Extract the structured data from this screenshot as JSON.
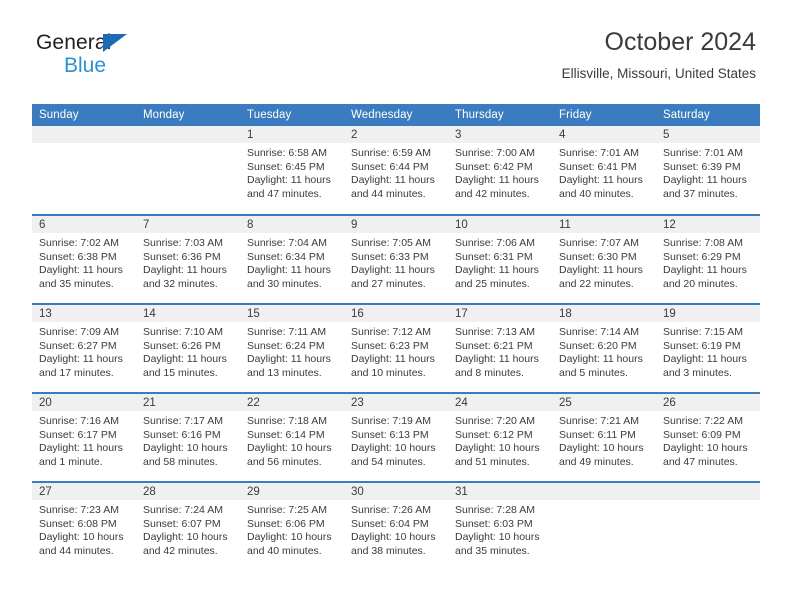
{
  "brand": {
    "name_top": "General",
    "name_bottom": "Blue",
    "triangle_color": "#1b6cb5",
    "blue_text_color": "#2d8fd5"
  },
  "header": {
    "title": "October 2024",
    "location": "Ellisville, Missouri, United States"
  },
  "theme": {
    "header_blue": "#3b7cc0",
    "daynum_band": "#f0f0f0",
    "text": "#3b3b3b"
  },
  "weekday_headers": [
    "Sunday",
    "Monday",
    "Tuesday",
    "Wednesday",
    "Thursday",
    "Friday",
    "Saturday"
  ],
  "weeks": [
    [
      {
        "day": "",
        "sunrise": "",
        "sunset": "",
        "daylight_line1": "",
        "daylight_line2": "",
        "blank": true
      },
      {
        "day": "",
        "sunrise": "",
        "sunset": "",
        "daylight_line1": "",
        "daylight_line2": "",
        "blank": true
      },
      {
        "day": "1",
        "sunrise": "Sunrise: 6:58 AM",
        "sunset": "Sunset: 6:45 PM",
        "daylight_line1": "Daylight: 11 hours",
        "daylight_line2": "and 47 minutes."
      },
      {
        "day": "2",
        "sunrise": "Sunrise: 6:59 AM",
        "sunset": "Sunset: 6:44 PM",
        "daylight_line1": "Daylight: 11 hours",
        "daylight_line2": "and 44 minutes."
      },
      {
        "day": "3",
        "sunrise": "Sunrise: 7:00 AM",
        "sunset": "Sunset: 6:42 PM",
        "daylight_line1": "Daylight: 11 hours",
        "daylight_line2": "and 42 minutes."
      },
      {
        "day": "4",
        "sunrise": "Sunrise: 7:01 AM",
        "sunset": "Sunset: 6:41 PM",
        "daylight_line1": "Daylight: 11 hours",
        "daylight_line2": "and 40 minutes."
      },
      {
        "day": "5",
        "sunrise": "Sunrise: 7:01 AM",
        "sunset": "Sunset: 6:39 PM",
        "daylight_line1": "Daylight: 11 hours",
        "daylight_line2": "and 37 minutes."
      }
    ],
    [
      {
        "day": "6",
        "sunrise": "Sunrise: 7:02 AM",
        "sunset": "Sunset: 6:38 PM",
        "daylight_line1": "Daylight: 11 hours",
        "daylight_line2": "and 35 minutes."
      },
      {
        "day": "7",
        "sunrise": "Sunrise: 7:03 AM",
        "sunset": "Sunset: 6:36 PM",
        "daylight_line1": "Daylight: 11 hours",
        "daylight_line2": "and 32 minutes."
      },
      {
        "day": "8",
        "sunrise": "Sunrise: 7:04 AM",
        "sunset": "Sunset: 6:34 PM",
        "daylight_line1": "Daylight: 11 hours",
        "daylight_line2": "and 30 minutes."
      },
      {
        "day": "9",
        "sunrise": "Sunrise: 7:05 AM",
        "sunset": "Sunset: 6:33 PM",
        "daylight_line1": "Daylight: 11 hours",
        "daylight_line2": "and 27 minutes."
      },
      {
        "day": "10",
        "sunrise": "Sunrise: 7:06 AM",
        "sunset": "Sunset: 6:31 PM",
        "daylight_line1": "Daylight: 11 hours",
        "daylight_line2": "and 25 minutes."
      },
      {
        "day": "11",
        "sunrise": "Sunrise: 7:07 AM",
        "sunset": "Sunset: 6:30 PM",
        "daylight_line1": "Daylight: 11 hours",
        "daylight_line2": "and 22 minutes."
      },
      {
        "day": "12",
        "sunrise": "Sunrise: 7:08 AM",
        "sunset": "Sunset: 6:29 PM",
        "daylight_line1": "Daylight: 11 hours",
        "daylight_line2": "and 20 minutes."
      }
    ],
    [
      {
        "day": "13",
        "sunrise": "Sunrise: 7:09 AM",
        "sunset": "Sunset: 6:27 PM",
        "daylight_line1": "Daylight: 11 hours",
        "daylight_line2": "and 17 minutes."
      },
      {
        "day": "14",
        "sunrise": "Sunrise: 7:10 AM",
        "sunset": "Sunset: 6:26 PM",
        "daylight_line1": "Daylight: 11 hours",
        "daylight_line2": "and 15 minutes."
      },
      {
        "day": "15",
        "sunrise": "Sunrise: 7:11 AM",
        "sunset": "Sunset: 6:24 PM",
        "daylight_line1": "Daylight: 11 hours",
        "daylight_line2": "and 13 minutes."
      },
      {
        "day": "16",
        "sunrise": "Sunrise: 7:12 AM",
        "sunset": "Sunset: 6:23 PM",
        "daylight_line1": "Daylight: 11 hours",
        "daylight_line2": "and 10 minutes."
      },
      {
        "day": "17",
        "sunrise": "Sunrise: 7:13 AM",
        "sunset": "Sunset: 6:21 PM",
        "daylight_line1": "Daylight: 11 hours",
        "daylight_line2": "and 8 minutes."
      },
      {
        "day": "18",
        "sunrise": "Sunrise: 7:14 AM",
        "sunset": "Sunset: 6:20 PM",
        "daylight_line1": "Daylight: 11 hours",
        "daylight_line2": "and 5 minutes."
      },
      {
        "day": "19",
        "sunrise": "Sunrise: 7:15 AM",
        "sunset": "Sunset: 6:19 PM",
        "daylight_line1": "Daylight: 11 hours",
        "daylight_line2": "and 3 minutes."
      }
    ],
    [
      {
        "day": "20",
        "sunrise": "Sunrise: 7:16 AM",
        "sunset": "Sunset: 6:17 PM",
        "daylight_line1": "Daylight: 11 hours",
        "daylight_line2": "and 1 minute."
      },
      {
        "day": "21",
        "sunrise": "Sunrise: 7:17 AM",
        "sunset": "Sunset: 6:16 PM",
        "daylight_line1": "Daylight: 10 hours",
        "daylight_line2": "and 58 minutes."
      },
      {
        "day": "22",
        "sunrise": "Sunrise: 7:18 AM",
        "sunset": "Sunset: 6:14 PM",
        "daylight_line1": "Daylight: 10 hours",
        "daylight_line2": "and 56 minutes."
      },
      {
        "day": "23",
        "sunrise": "Sunrise: 7:19 AM",
        "sunset": "Sunset: 6:13 PM",
        "daylight_line1": "Daylight: 10 hours",
        "daylight_line2": "and 54 minutes."
      },
      {
        "day": "24",
        "sunrise": "Sunrise: 7:20 AM",
        "sunset": "Sunset: 6:12 PM",
        "daylight_line1": "Daylight: 10 hours",
        "daylight_line2": "and 51 minutes."
      },
      {
        "day": "25",
        "sunrise": "Sunrise: 7:21 AM",
        "sunset": "Sunset: 6:11 PM",
        "daylight_line1": "Daylight: 10 hours",
        "daylight_line2": "and 49 minutes."
      },
      {
        "day": "26",
        "sunrise": "Sunrise: 7:22 AM",
        "sunset": "Sunset: 6:09 PM",
        "daylight_line1": "Daylight: 10 hours",
        "daylight_line2": "and 47 minutes."
      }
    ],
    [
      {
        "day": "27",
        "sunrise": "Sunrise: 7:23 AM",
        "sunset": "Sunset: 6:08 PM",
        "daylight_line1": "Daylight: 10 hours",
        "daylight_line2": "and 44 minutes."
      },
      {
        "day": "28",
        "sunrise": "Sunrise: 7:24 AM",
        "sunset": "Sunset: 6:07 PM",
        "daylight_line1": "Daylight: 10 hours",
        "daylight_line2": "and 42 minutes."
      },
      {
        "day": "29",
        "sunrise": "Sunrise: 7:25 AM",
        "sunset": "Sunset: 6:06 PM",
        "daylight_line1": "Daylight: 10 hours",
        "daylight_line2": "and 40 minutes."
      },
      {
        "day": "30",
        "sunrise": "Sunrise: 7:26 AM",
        "sunset": "Sunset: 6:04 PM",
        "daylight_line1": "Daylight: 10 hours",
        "daylight_line2": "and 38 minutes."
      },
      {
        "day": "31",
        "sunrise": "Sunrise: 7:28 AM",
        "sunset": "Sunset: 6:03 PM",
        "daylight_line1": "Daylight: 10 hours",
        "daylight_line2": "and 35 minutes."
      },
      {
        "day": "",
        "sunrise": "",
        "sunset": "",
        "daylight_line1": "",
        "daylight_line2": "",
        "blank": true
      },
      {
        "day": "",
        "sunrise": "",
        "sunset": "",
        "daylight_line1": "",
        "daylight_line2": "",
        "blank": true
      }
    ]
  ]
}
